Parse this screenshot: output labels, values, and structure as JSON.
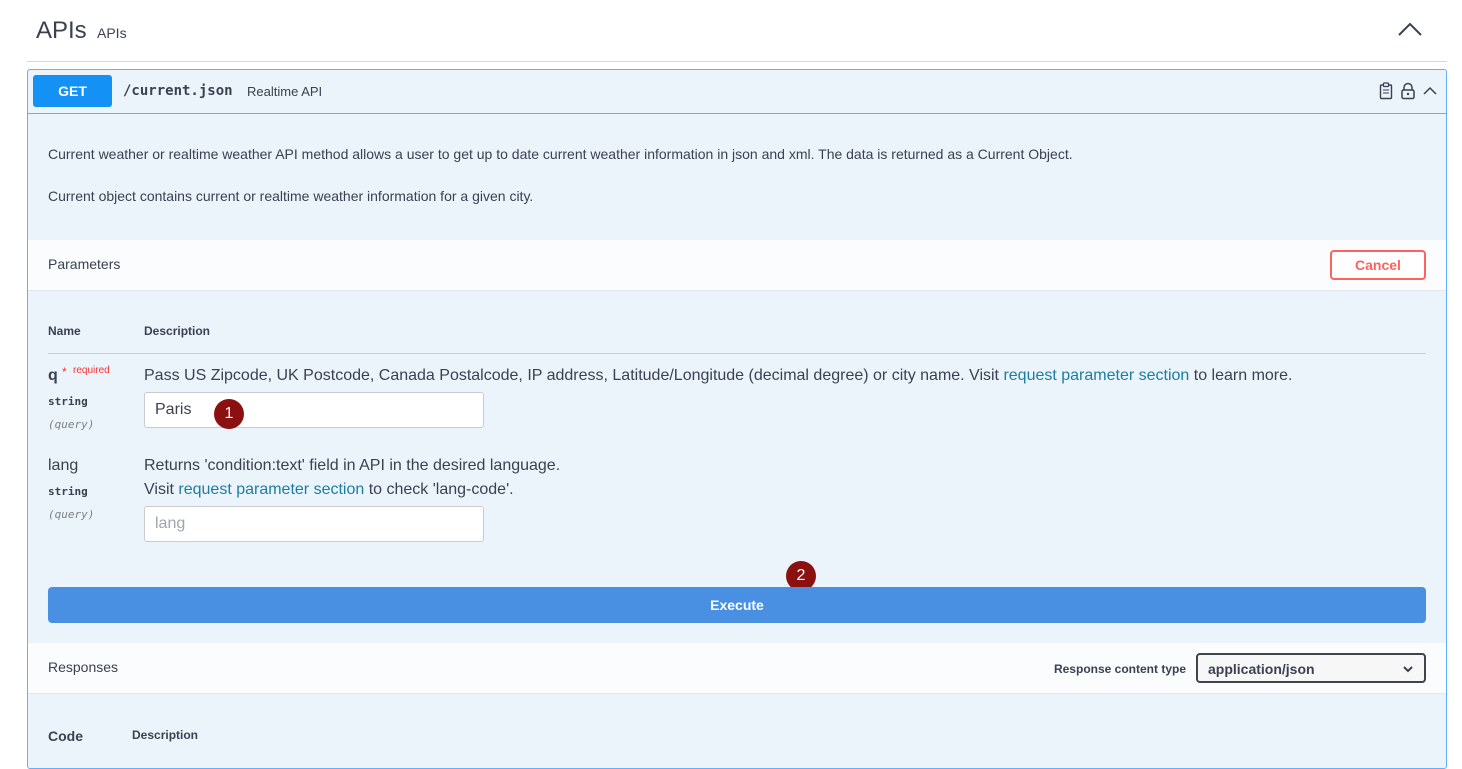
{
  "section": {
    "title": "APIs",
    "subtitle": "APIs"
  },
  "operation": {
    "method": "GET",
    "path": "/current.json",
    "summary": "Realtime API",
    "description_1": "Current weather or realtime weather API method allows a user to get up to date current weather information in json and xml. The data is returned as a Current Object.",
    "description_2": "Current object contains current or realtime weather information for a given city.",
    "icons": [
      "clipboard-icon",
      "lock-icon",
      "chevron-up-icon"
    ]
  },
  "parameters": {
    "title": "Parameters",
    "cancel_label": "Cancel",
    "col_name": "Name",
    "col_description": "Description",
    "q": {
      "name": "q",
      "star": "*",
      "required": "required",
      "type": "string",
      "in": "(query)",
      "desc_before": "Pass US Zipcode, UK Postcode, Canada Postalcode, IP address, Latitude/Longitude (decimal degree) or city name. Visit ",
      "desc_link": "request parameter section",
      "desc_after": " to learn more.",
      "value": "Paris"
    },
    "lang": {
      "name": "lang",
      "type": "string",
      "in": "(query)",
      "desc_line1": "Returns 'condition:text' field in API in the desired language.",
      "desc_before": "Visit ",
      "desc_link": "request parameter section",
      "desc_after": " to check 'lang-code'.",
      "placeholder": "lang"
    }
  },
  "markers": {
    "one": "1",
    "two": "2"
  },
  "execute_label": "Execute",
  "responses": {
    "title": "Responses",
    "content_type_label": "Response content type",
    "content_type_value": "application/json",
    "col_code": "Code",
    "col_description": "Description"
  },
  "colors": {
    "get": "#1391f5",
    "execute": "#4990e2",
    "cancel": "#ff6060",
    "marker": "#8b1111",
    "link": "#1c7d9f"
  }
}
